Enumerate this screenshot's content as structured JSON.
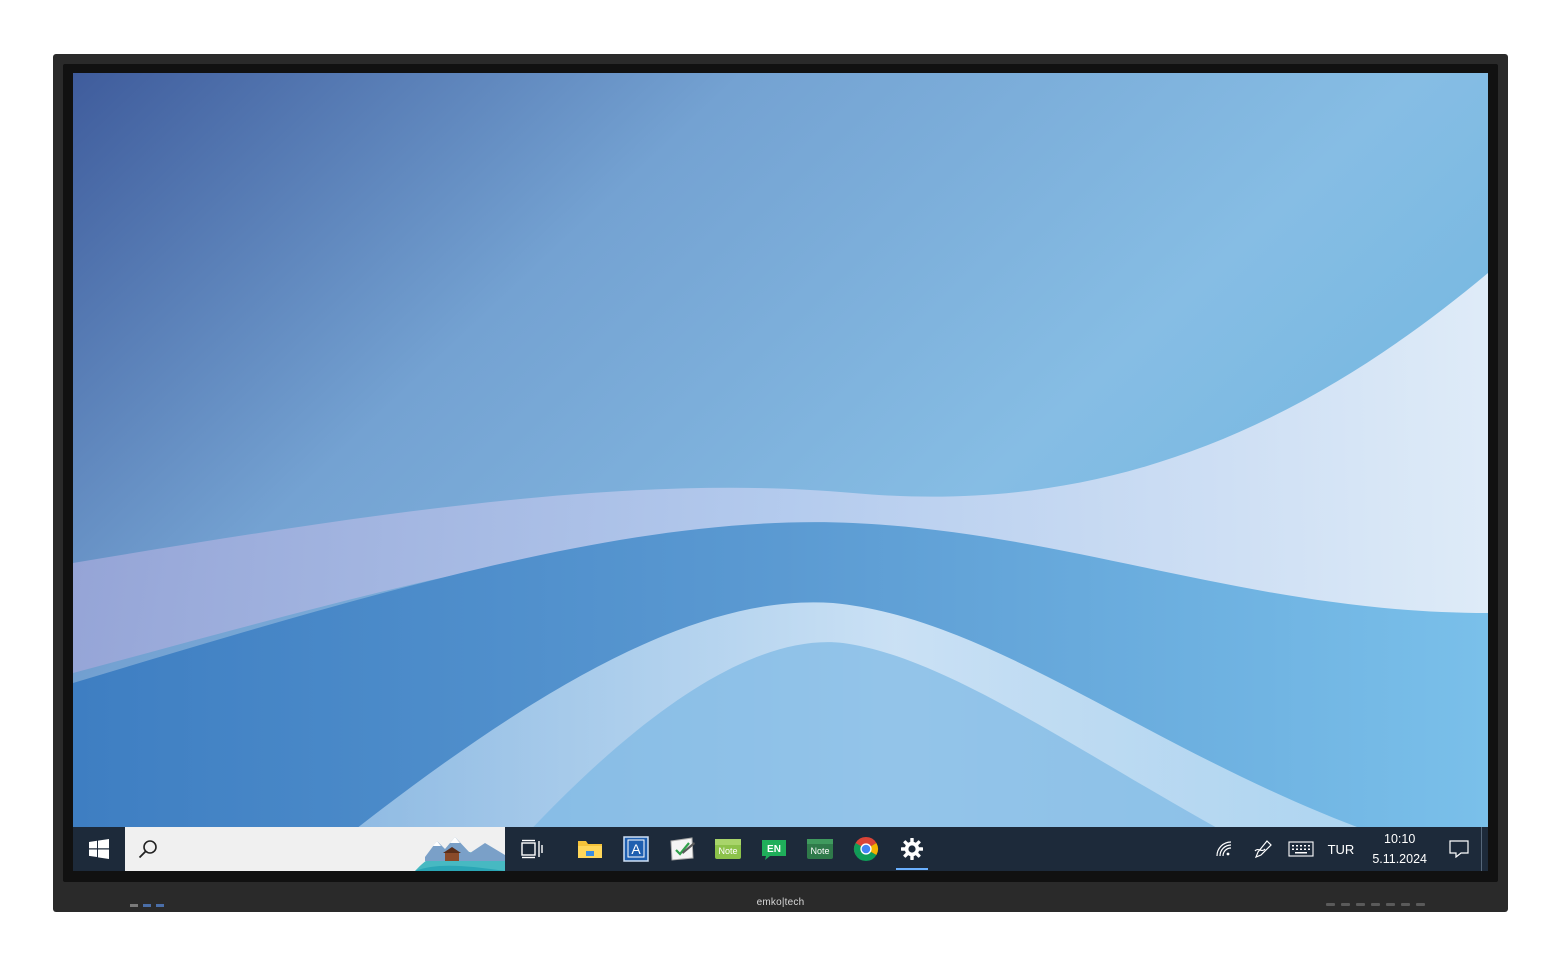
{
  "device": {
    "brand_label": "emko|tech"
  },
  "taskbar": {
    "search": {
      "placeholder": "",
      "value": ""
    },
    "pinned_apps": [
      {
        "name": "File Explorer",
        "icon": "folder-icon"
      },
      {
        "name": "Teaching app",
        "icon": "app-a-icon"
      },
      {
        "name": "Whiteboard",
        "icon": "whiteboard-icon"
      },
      {
        "name": "Note",
        "icon": "note-icon",
        "label": "Note"
      },
      {
        "name": "EN",
        "icon": "en-icon",
        "label": "EN"
      },
      {
        "name": "Note",
        "icon": "note-dark-icon",
        "label": "Note"
      },
      {
        "name": "Google Chrome",
        "icon": "chrome-icon"
      },
      {
        "name": "Settings",
        "icon": "settings-icon",
        "active": true
      }
    ],
    "tray": {
      "language": "TUR",
      "time": "10:10",
      "date": "5.11.2024"
    }
  },
  "colors": {
    "taskbar_bg": "#1d2a3a",
    "wallpaper_top_left": "#3f5f9e",
    "wallpaper_right": "#7cc0e6",
    "active_indicator": "#6ab0ff"
  }
}
